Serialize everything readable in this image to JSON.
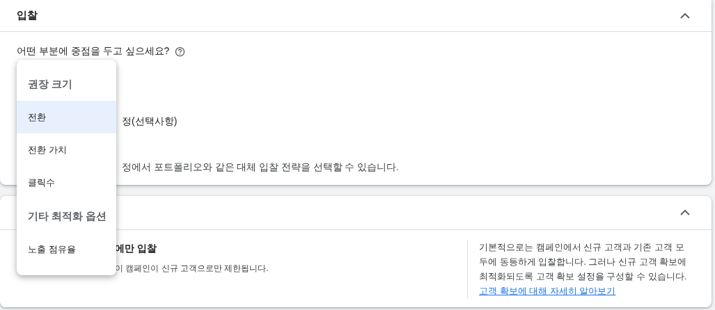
{
  "bidding_section": {
    "title": "입찰",
    "expanded": true,
    "question": "어떤 부분에 중점을 두고 싶으세요?",
    "partial_option_label": "정(선택사항)",
    "partial_note": "정에서 포트폴리오와 같은 대체 입찰 전략을 선택할 수 있습니다."
  },
  "dropdown": {
    "groups": [
      {
        "heading": "권장 크기",
        "items": [
          {
            "label": "전환",
            "selected": true
          },
          {
            "label": "전환 가치",
            "selected": false
          },
          {
            "label": "클릭수",
            "selected": false
          }
        ]
      },
      {
        "heading": "기타 최적화 옵션",
        "items": [
          {
            "label": "노출 점유율",
            "selected": false
          }
        ]
      }
    ]
  },
  "customer_acquisition_section": {
    "expanded": true,
    "option_title": "에만 입찰",
    "option_note": "이 캠페인이 신규 고객으로만 제한됩니다.",
    "help_text": "기본적으로는 캠페인에서 신규 고객과 기존 고객 모두에 동등하게 입찰합니다. 그러나 신규 고객 확보에 최적화되도록 고객 확보 설정을 구성할 수 있습니다. ",
    "help_link": "고객 확보에 대해 자세히 알아보기"
  }
}
